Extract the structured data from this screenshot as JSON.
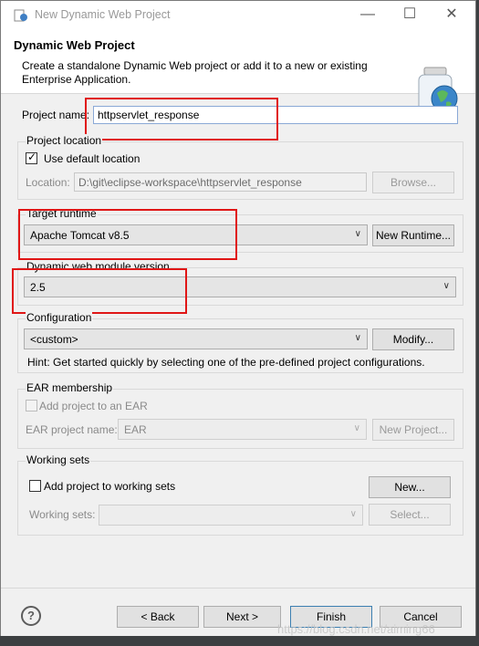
{
  "window": {
    "title": "New Dynamic Web Project"
  },
  "header": {
    "title": "Dynamic Web Project",
    "description": "Create a standalone Dynamic Web project or add it to a new or existing Enterprise Application."
  },
  "project_name": {
    "label": "Project name:",
    "value": "httpservlet_response"
  },
  "project_location": {
    "group_label": "Project location",
    "use_default_label": "Use default location",
    "location_label": "Location:",
    "location_value": "D:\\git\\eclipse-workspace\\httpservlet_response",
    "browse_label": "Browse..."
  },
  "target_runtime": {
    "group_label": "Target runtime",
    "selected": "Apache Tomcat v8.5",
    "new_runtime_label": "New Runtime..."
  },
  "module_version": {
    "group_label": "Dynamic web module version",
    "selected": "2.5"
  },
  "configuration": {
    "group_label": "Configuration",
    "selected": "<custom>",
    "modify_label": "Modify...",
    "hint": "Hint: Get started quickly by selecting one of the pre-defined project configurations."
  },
  "ear": {
    "group_label": "EAR membership",
    "add_label": "Add project to an EAR",
    "name_label": "EAR project name:",
    "name_value": "EAR",
    "new_project_label": "New Project..."
  },
  "working_sets": {
    "group_label": "Working sets",
    "add_label": "Add project to working sets",
    "new_label": "New...",
    "sets_label": "Working sets:",
    "select_label": "Select..."
  },
  "footer": {
    "back_label": "< Back",
    "next_label": "Next >",
    "finish_label": "Finish",
    "cancel_label": "Cancel"
  },
  "watermark": "https://blog.csdn.net/aiming66"
}
